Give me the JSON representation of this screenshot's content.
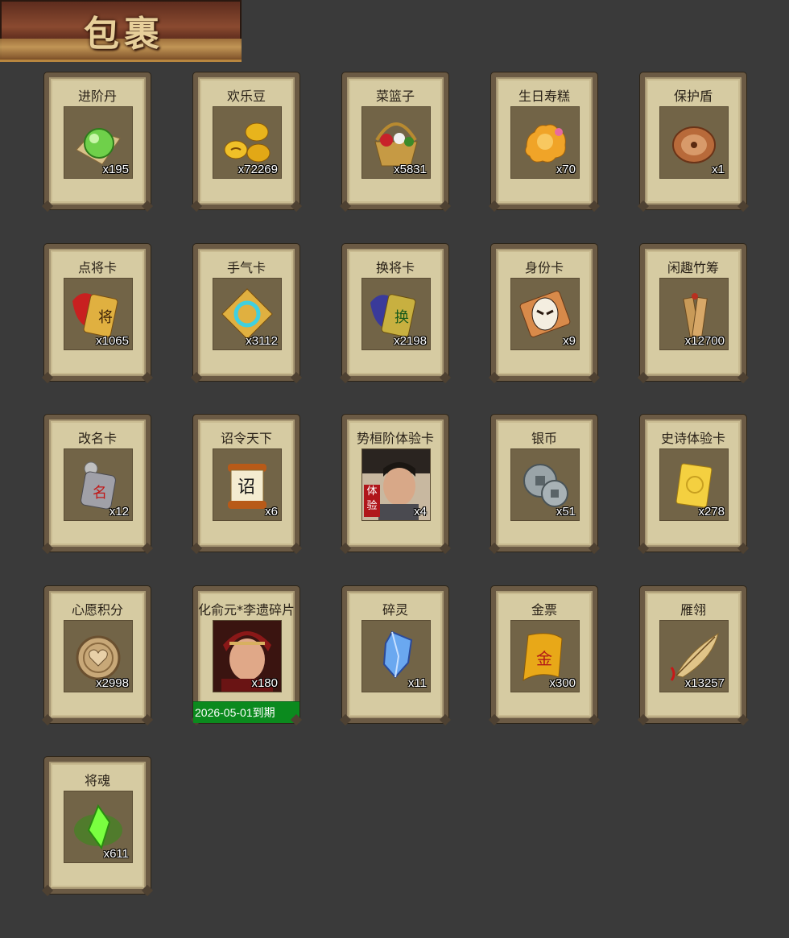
{
  "header": {
    "title": "包裹"
  },
  "items": [
    {
      "name": "进阶丹",
      "qty": "x195",
      "icon": "green-orb-icon"
    },
    {
      "name": "欢乐豆",
      "qty": "x72269",
      "icon": "gold-beans-icon"
    },
    {
      "name": "菜篮子",
      "qty": "x5831",
      "icon": "basket-icon"
    },
    {
      "name": "生日寿糕",
      "qty": "x70",
      "icon": "cake-icon"
    },
    {
      "name": "保护盾",
      "qty": "x1",
      "icon": "shield-icon"
    },
    {
      "name": "点将卡",
      "qty": "x1065",
      "icon": "general-card-icon"
    },
    {
      "name": "手气卡",
      "qty": "x3112",
      "icon": "luck-card-icon"
    },
    {
      "name": "换将卡",
      "qty": "x2198",
      "icon": "swap-card-icon"
    },
    {
      "name": "身份卡",
      "qty": "x9",
      "icon": "mask-card-icon"
    },
    {
      "name": "闲趣竹筹",
      "qty": "x12700",
      "icon": "bamboo-token-icon"
    },
    {
      "name": "改名卡",
      "qty": "x12",
      "icon": "rename-card-icon"
    },
    {
      "name": "诏令天下",
      "qty": "x6",
      "icon": "edict-scroll-icon"
    },
    {
      "name": "势桓阶体验卡",
      "qty": "x4",
      "icon": "hero-portrait-icon",
      "tag": "体验"
    },
    {
      "name": "银币",
      "qty": "x51",
      "icon": "silver-coin-icon"
    },
    {
      "name": "史诗体验卡",
      "qty": "x278",
      "icon": "epic-card-icon"
    },
    {
      "name": "心愿积分",
      "qty": "x2998",
      "icon": "heart-coin-icon"
    },
    {
      "name": "化俞元*李遗碎片",
      "qty": "x180",
      "icon": "hero-fragment-icon",
      "expiry": "2026-05-01到期"
    },
    {
      "name": "碎灵",
      "qty": "x11",
      "icon": "crystal-shard-icon"
    },
    {
      "name": "金票",
      "qty": "x300",
      "icon": "gold-ticket-icon"
    },
    {
      "name": "雁翎",
      "qty": "x13257",
      "icon": "feather-icon"
    },
    {
      "name": "将魂",
      "qty": "x611",
      "icon": "green-soul-icon"
    }
  ],
  "colors": {
    "background": "#3a3a3a",
    "card": "#d6cba2",
    "card_border": "#6b5a44",
    "expiry_bar": "#0b8a1e",
    "header_text": "#e7cf9a"
  }
}
